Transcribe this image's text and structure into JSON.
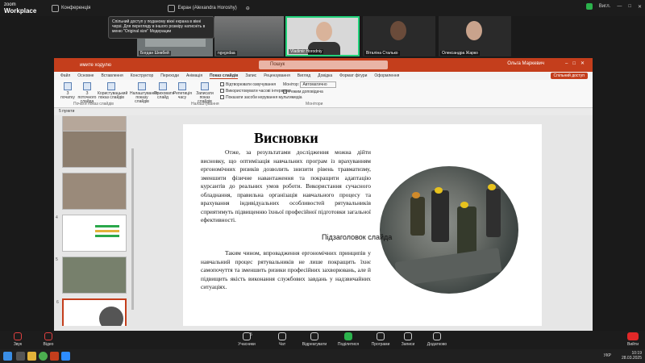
{
  "zoom": {
    "brand_line1": "zoom",
    "brand_line2": "Workplace",
    "tab_conference": "Конференція",
    "tab_share": "Екран (Alexandra Horoshy)",
    "top_right": "Вигл.",
    "tooltip": "Спільний доступ у поданому вікні екрана в вікні черзі. Для перегляду в іншого розміру натисніть в меню \"Original size\" Модерации",
    "participants": [
      {
        "name": "Богдан Шевбей"
      },
      {
        "name": "ngvgxdaa"
      },
      {
        "name": "Vladimir Horodniy"
      },
      {
        "name": "Віталіна Сталько"
      },
      {
        "name": "Олександра Жарко"
      }
    ],
    "toolbar": {
      "audio": "Звук",
      "video": "Відео",
      "participants": "Учасники",
      "participants_count": "5",
      "chat": "Чат",
      "react": "Відреагувати",
      "share": "Поділитися",
      "apps": "Програми",
      "notes": "Записи",
      "more": "Додатково",
      "leave": "Вийти"
    }
  },
  "powerpoint": {
    "doc_name": "имите ходулю",
    "search_placeholder": "Пошук",
    "user": "Ольга Маркевич",
    "share_button": "Спільний доступ",
    "tabs": [
      "Файл",
      "Основне",
      "Вставлення",
      "Конструктор",
      "Переходи",
      "Анімація",
      "Показ слайдів",
      "Запис",
      "Рецензування",
      "Вигляд",
      "Довідка",
      "Формат фігури",
      "Оформлення"
    ],
    "selected_tab": "Показ слайдів",
    "ribbon": {
      "btn1": "З початку",
      "btn2": "З поточного слайда",
      "btn3": "Користувацький показ слайдів",
      "btn4": "Налаштування показу слайдів",
      "btn5": "Приховати слайд",
      "btn6": "Репетиція часу",
      "btn7": "Записати показ слайдів",
      "chk1": "Відтворювати озвучування",
      "chk2": "Використовувати часові інтервали",
      "chk3": "Показати засоби керування мультимедіа",
      "monitor_label": "Монітор:",
      "monitor_value": "Автоматично",
      "presenter_view": "Режим доповідача",
      "group1": "Почати показ слайдів",
      "group2": "Налаштування",
      "group3": "Монітори"
    },
    "qat": "5 пункти",
    "slide_numbers": [
      "",
      "",
      "4",
      "5",
      "6"
    ]
  },
  "slide": {
    "title": "Висновки",
    "para1": "Отже, за результатами дослідження можна дійти висновку, що оптимізація навчальних програм із врахуванням ергономічних ризиків дозволить знизити рівень травматизму, зменшити фізичне навантаження та покращити адаптацію курсантів до реальних умов роботи. Використання сучасного обладнання, правильна організація навчального процесу та врахування індивідуальних особливостей рятувальників сприятимуть підвищенню їхньої професійної підготовки загальної ефективності.",
    "para2": "Таким чином, впровадження ергономічних принципів у навчальний процес рятувальників не лише покращить їхнє самопочуття та зменшить ризики професійних захворювань, але й підвищить якість виконання службових завдань у надзвичайних ситуаціях.",
    "placeholder_label": "Підзаголовок слайда"
  },
  "taskbar": {
    "lang": "УКР",
    "time": "10:19",
    "date": "28.03.2025"
  }
}
